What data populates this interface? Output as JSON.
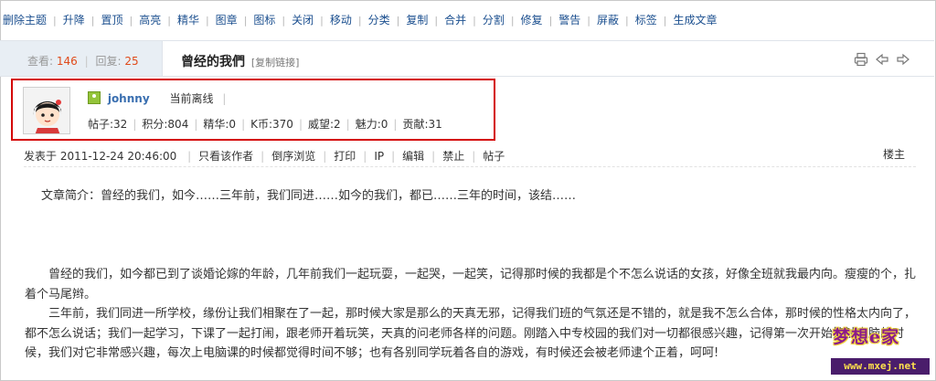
{
  "toolbar": {
    "items": [
      "删除主题",
      "升降",
      "置顶",
      "高亮",
      "精华",
      "图章",
      "图标",
      "关闭",
      "移动",
      "分类",
      "复制",
      "合并",
      "分割",
      "修复",
      "警告",
      "屏蔽",
      "标签",
      "生成文章"
    ]
  },
  "thread": {
    "views_label": "查看:",
    "views": "146",
    "replies_label": "回复:",
    "replies": "25",
    "title": "曾经的我們",
    "copy_link": "[复制链接]",
    "icons": [
      "print-icon",
      "prev-thread-icon",
      "next-thread-icon"
    ]
  },
  "author": {
    "username": "johnny",
    "status": "当前离线",
    "stats": [
      "帖子:32",
      "积分:804",
      "精华:0",
      "K币:370",
      "威望:2",
      "魅力:0",
      "贡献:31"
    ]
  },
  "post": {
    "date": "发表于 2011-12-24 20:46:00",
    "actions": [
      "只看该作者",
      "倒序浏览",
      "打印",
      "IP",
      "编辑",
      "禁止",
      "帖子"
    ],
    "floor": "楼主",
    "summary": "文章简介：曾经的我们，如今……三年前，我们同进……如今的我们，都已……三年的时间，该结……",
    "paragraphs": [
      "　　曾经的我们，如今都已到了谈婚论嫁的年龄，几年前我们一起玩耍，一起哭，一起笑，记得那时候的我都是个不怎么说话的女孩，好像全班就我最内向。瘦瘦的个，扎着个马尾辫。",
      "　　三年前，我们同进一所学校，缘份让我们相聚在了一起，那时候大家是那么的天真无邪，记得我们班的气氛还是不错的，就是我不怎么合体，那时候的性格太内向了，都不怎么说话；我们一起学习，下课了一起打闹，跟老师开着玩笑，天真的问老师各样的问题。刚踏入中专校园的我们对一切都很感兴趣，记得第一次开始接触电脑的时候，我们对它非常感兴趣，每次上电脑课的时候都觉得时间不够；也有各别同学玩着各自的游戏，有时候还会被老师逮个正着，呵呵!"
    ]
  },
  "watermark": {
    "title": "梦想e家",
    "url": "www.mxej.net"
  },
  "colors": {
    "link": "#1b4f8f",
    "highlight_number": "#e04a1a",
    "author_box_border": "#d40000",
    "stats_bg": "#e8eef4"
  }
}
